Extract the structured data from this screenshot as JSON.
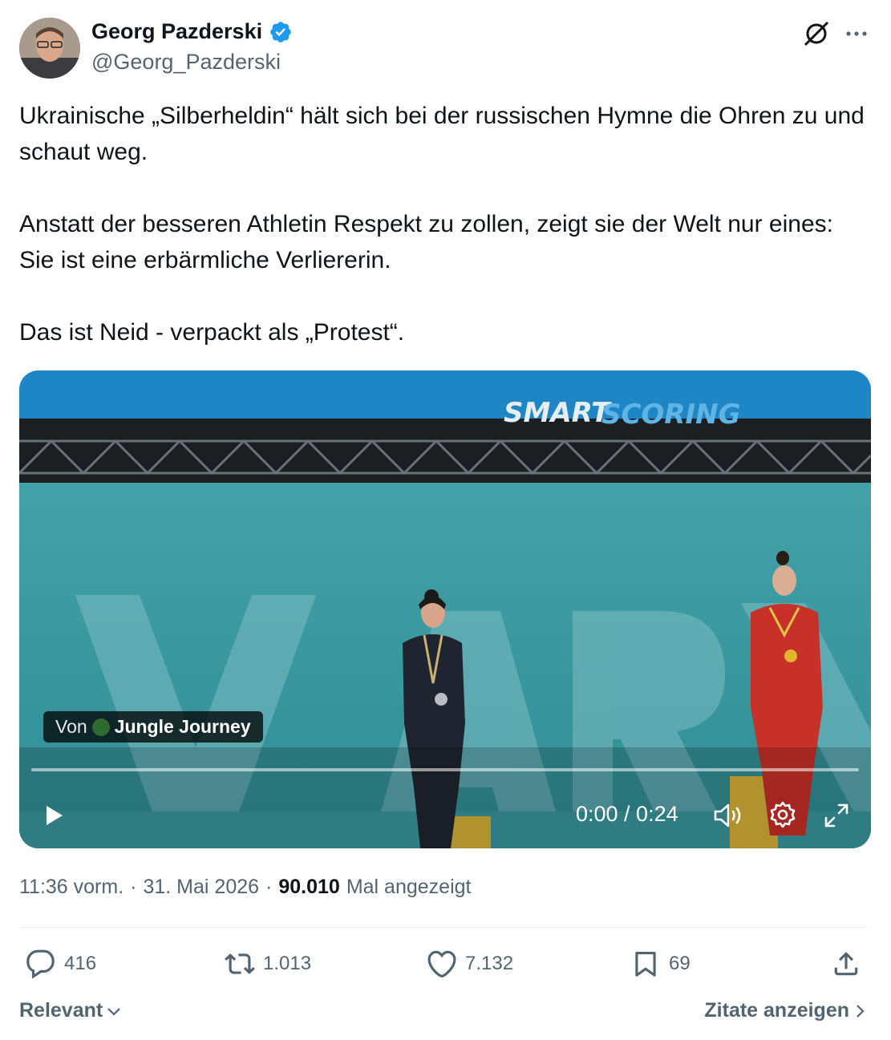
{
  "author": {
    "name": "Georg Pazderski",
    "handle": "@Georg_Pazderski",
    "verified": true
  },
  "tweet": {
    "paragraphs": [
      "Ukrainische „Silberheldin“ hält sich bei der russischen Hymne die Ohren zu und schaut weg.",
      "Anstatt der besseren Athletin Respekt zu zollen, zeigt sie der Welt nur eines: Sie ist eine erbärmliche Verliererin.",
      "Das ist Neid - verpackt als „Protest“."
    ]
  },
  "video": {
    "source_prefix": "Von",
    "source_name": "Jungle Journey",
    "time": "0:00 / 0:24",
    "progress": 0,
    "banner_text_a": "SMART",
    "banner_text_b": "SCORING"
  },
  "meta": {
    "time": "11:36 vorm.",
    "separator": "·",
    "date": "31. Mai 2026",
    "views": "90.010",
    "views_label": "Mal angezeigt"
  },
  "actions": {
    "replies": "416",
    "retweets": "1.013",
    "likes": "7.132",
    "bookmarks": "69"
  },
  "footer": {
    "sort_label": "Relevant",
    "quotes_label": "Zitate anzeigen"
  },
  "colors": {
    "text": "#0f1419",
    "secondary": "#536471",
    "verified": "#1d9bf0"
  },
  "icons": [
    "verified-badge-icon",
    "grok-icon",
    "more-icon",
    "play-icon",
    "volume-icon",
    "settings-icon",
    "fullscreen-icon",
    "reply-icon",
    "retweet-icon",
    "like-icon",
    "bookmark-icon",
    "share-icon",
    "chevron-down-icon",
    "chevron-right-icon"
  ]
}
